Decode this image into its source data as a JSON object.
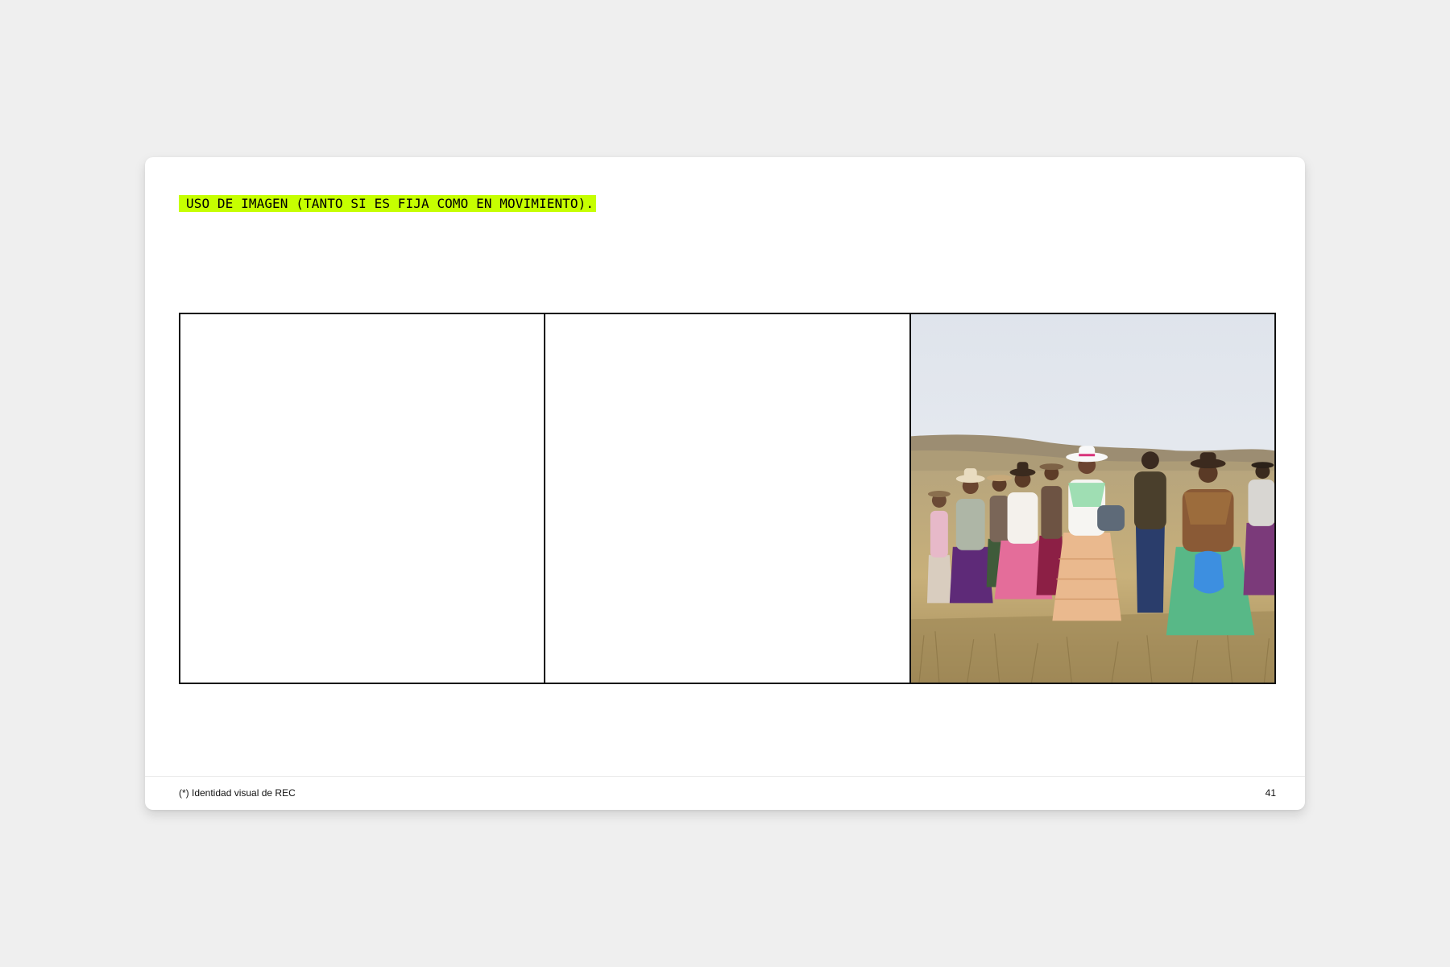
{
  "page": {
    "heading": "USO DE IMAGEN (TANTO SI ES FIJA COMO EN MOVIMIENTO).",
    "accent_color": "#c6ff00"
  },
  "panels": [
    {
      "content": "empty"
    },
    {
      "content": "empty"
    },
    {
      "content": "photo",
      "icon": "photo-group-of-women-in-highland-field"
    }
  ],
  "footer": {
    "note": "(*) Identidad visual de REC",
    "page_number": "41"
  }
}
